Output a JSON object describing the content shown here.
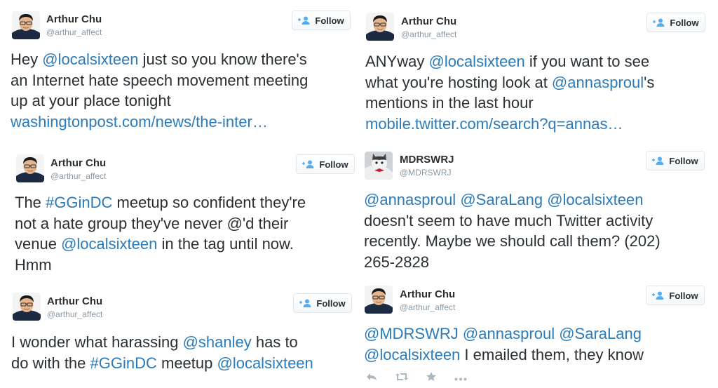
{
  "follow_label": "Follow",
  "tweets": [
    {
      "name": "Arthur Chu",
      "handle": "@arthur_affect",
      "t": [
        "Hey ",
        "@localsixteen",
        " just so you know there's",
        "an Internet hate speech movement meeting",
        "up at your place tonight",
        "washingtonpost.com/news/the-inter…"
      ]
    },
    {
      "name": "Arthur Chu",
      "handle": "@arthur_affect",
      "t": [
        "ANYway ",
        "@localsixteen",
        " if you want to see",
        "what you're hosting look at ",
        "@annasproul",
        "'s",
        "mentions in the last hour",
        "mobile.twitter.com/search?q=annas…"
      ]
    },
    {
      "name": "Arthur Chu",
      "handle": "@arthur_affect",
      "t": [
        "The ",
        "#GGinDC",
        " meetup so confident they're",
        "not a hate group they've never @'d their",
        "venue ",
        "@localsixteen",
        " in the tag until now.",
        "Hmm"
      ]
    },
    {
      "name": "MDRSWRJ",
      "handle": "@MDRSWRJ",
      "t": [
        "@annasproul",
        "@SaraLang",
        "@localsixteen",
        "doesn't seem to have much Twitter activity",
        "recently. Maybe we should call them? (202)",
        "265-2828"
      ]
    },
    {
      "name": "Arthur Chu",
      "handle": "@arthur_affect",
      "t": [
        "I wonder what harassing ",
        "@shanley",
        " has to",
        "do with the ",
        "#GGinDC",
        " meetup ",
        "@localsixteen"
      ]
    },
    {
      "name": "Arthur Chu",
      "handle": "@arthur_affect",
      "t": [
        "@MDRSWRJ",
        "@annasproul",
        "@SaraLang",
        "@localsixteen",
        " I emailed them, they know"
      ]
    }
  ],
  "colors": {
    "link": "#2b7bb9",
    "text": "#292f33",
    "muted": "#8899a6",
    "follow_icon": "#55acee"
  },
  "icons": {
    "follow": "person-add-icon",
    "reply": "reply-icon",
    "retweet": "retweet-icon",
    "favorite": "star-icon",
    "more": "more-icon"
  }
}
